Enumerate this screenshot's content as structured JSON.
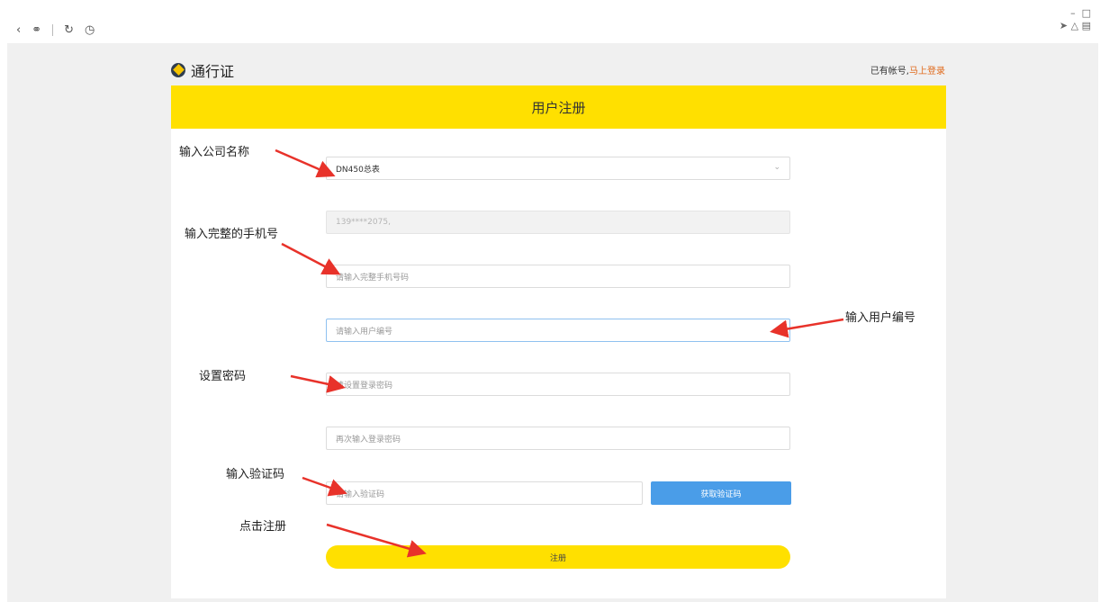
{
  "header": {
    "brand": "通行证",
    "login_hint": "已有帐号,",
    "login_link": "马上登录"
  },
  "form": {
    "title": "用户注册",
    "company_value": "DN450总表",
    "phone_masked": "139****2075,",
    "phone_placeholder": "请输入完整手机号码",
    "user_no_placeholder": "请输入用户编号",
    "password_placeholder": "请设置登录密码",
    "password_confirm_placeholder": "再次输入登录密码",
    "captcha_placeholder": "请输入验证码",
    "captcha_button": "获取验证码",
    "submit_label": "注册"
  },
  "annotations": {
    "company": "输入公司名称",
    "phone": "输入完整的手机号",
    "user_no": "输入用户编号",
    "password": "设置密码",
    "captcha": "输入验证码",
    "submit": "点击注册"
  },
  "colors": {
    "accent_yellow": "#ffe000",
    "button_blue": "#4a9de8",
    "link_orange": "#e0691a",
    "arrow_red": "#e8322a"
  },
  "icons": [
    "back-icon",
    "link-icon",
    "refresh-icon",
    "globe-icon",
    "minimize-icon",
    "restore-icon",
    "share-icon",
    "cube-icon",
    "panel-icon",
    "chevron-down-icon"
  ]
}
